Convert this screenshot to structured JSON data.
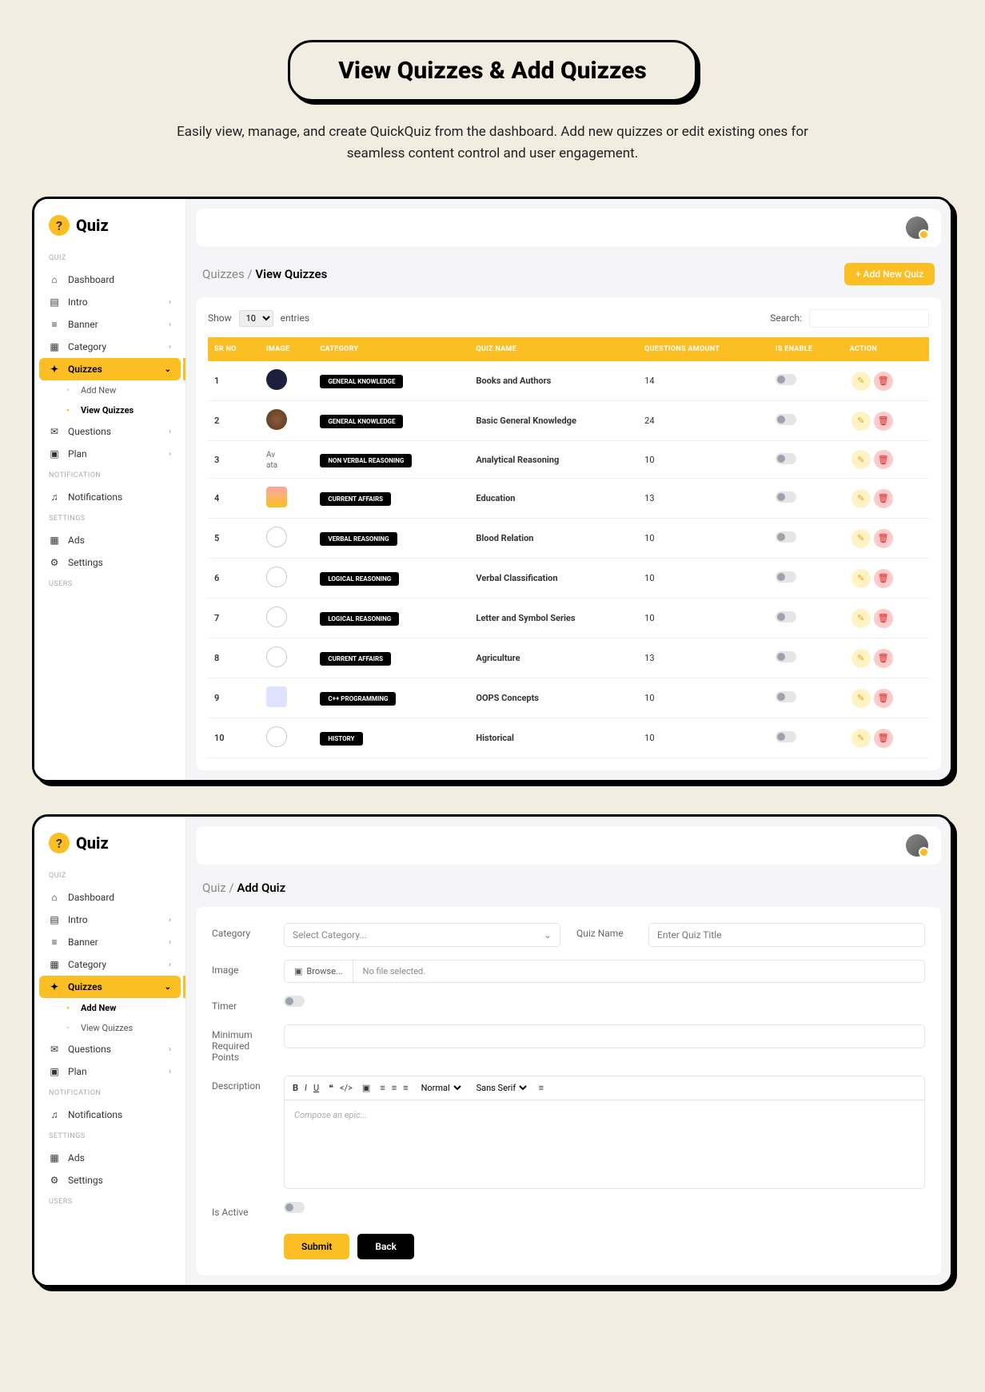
{
  "page_title": "View Quizzes & Add Quizzes",
  "page_subtitle": "Easily view, manage, and create QuickQuiz from the dashboard. Add new quizzes or edit existing ones for seamless content control and user engagement.",
  "logo_text": "Quiz",
  "sidebar": {
    "sections": {
      "quiz_label": "QUIZ",
      "notification_label": "NOTIFICATION",
      "settings_label": "SETTINGS",
      "users_label": "USERS"
    },
    "items": {
      "dashboard": "Dashboard",
      "intro": "Intro",
      "banner": "Banner",
      "category": "Category",
      "quizzes": "Quizzes",
      "add_new": "Add New",
      "view_quizzes": "View Quizzes",
      "questions": "Questions",
      "plan": "Plan",
      "notifications": "Notifications",
      "ads": "Ads",
      "settings": "Settings"
    }
  },
  "view_screen": {
    "breadcrumb_parent": "Quizzes",
    "breadcrumb_current": "View Quizzes",
    "add_button": "+ Add New Quiz",
    "show_label": "Show",
    "entries_value": "10",
    "entries_label": "entries",
    "search_label": "Search:",
    "columns": {
      "sr": "SR NO",
      "image": "IMAGE",
      "category": "CATEGORY",
      "quiz_name": "QUIZ NAME",
      "questions_amount": "QUESTIONS AMOUNT",
      "is_enable": "IS ENABLE",
      "action": "ACTION"
    },
    "rows": [
      {
        "sr": "1",
        "img": "circle-dark",
        "category": "GENERAL KNOWLEDGE",
        "name": "Books and Authors",
        "qty": "14"
      },
      {
        "sr": "2",
        "img": "circle-photo",
        "category": "GENERAL KNOWLEDGE",
        "name": "Basic General Knowledge",
        "qty": "24"
      },
      {
        "sr": "3",
        "img": "avata-text",
        "category": "NON VERBAL REASONING",
        "name": "Analytical Reasoning",
        "qty": "10"
      },
      {
        "sr": "4",
        "img": "square-books",
        "category": "CURRENT AFFAIRS",
        "name": "Education",
        "qty": "13"
      },
      {
        "sr": "5",
        "img": "people-icon",
        "category": "VERBAL REASONING",
        "name": "Blood Relation",
        "qty": "10"
      },
      {
        "sr": "6",
        "img": "shapes-icon",
        "category": "LOGICAL REASONING",
        "name": "Verbal Classification",
        "qty": "10"
      },
      {
        "sr": "7",
        "img": "venn-icon",
        "category": "LOGICAL REASONING",
        "name": "Letter and Symbol Series",
        "qty": "10"
      },
      {
        "sr": "8",
        "img": "crops-icon",
        "category": "CURRENT AFFAIRS",
        "name": "Agriculture",
        "qty": "13"
      },
      {
        "sr": "9",
        "img": "cpp-icon",
        "category": "C++ PROGRAMMING",
        "name": "OOPS Concepts",
        "qty": "10"
      },
      {
        "sr": "10",
        "img": "globe-icon",
        "category": "HISTORY",
        "name": "Historical",
        "qty": "10"
      }
    ]
  },
  "add_screen": {
    "breadcrumb_parent": "Quiz",
    "breadcrumb_current": "Add Quiz",
    "labels": {
      "category": "Category",
      "category_placeholder": "Select Category...",
      "quiz_name": "Quiz Name",
      "quiz_name_placeholder": "Enter Quiz Title",
      "image": "Image",
      "browse": "Browse...",
      "no_file": "No file selected.",
      "timer": "Timer",
      "min_points": "Minimum Required Points",
      "description": "Description",
      "compose": "Compose an epic...",
      "is_active": "Is Active",
      "submit": "Submit",
      "back": "Back"
    },
    "editor_toolbar": {
      "normal": "Normal",
      "font": "Sans Serif"
    }
  }
}
